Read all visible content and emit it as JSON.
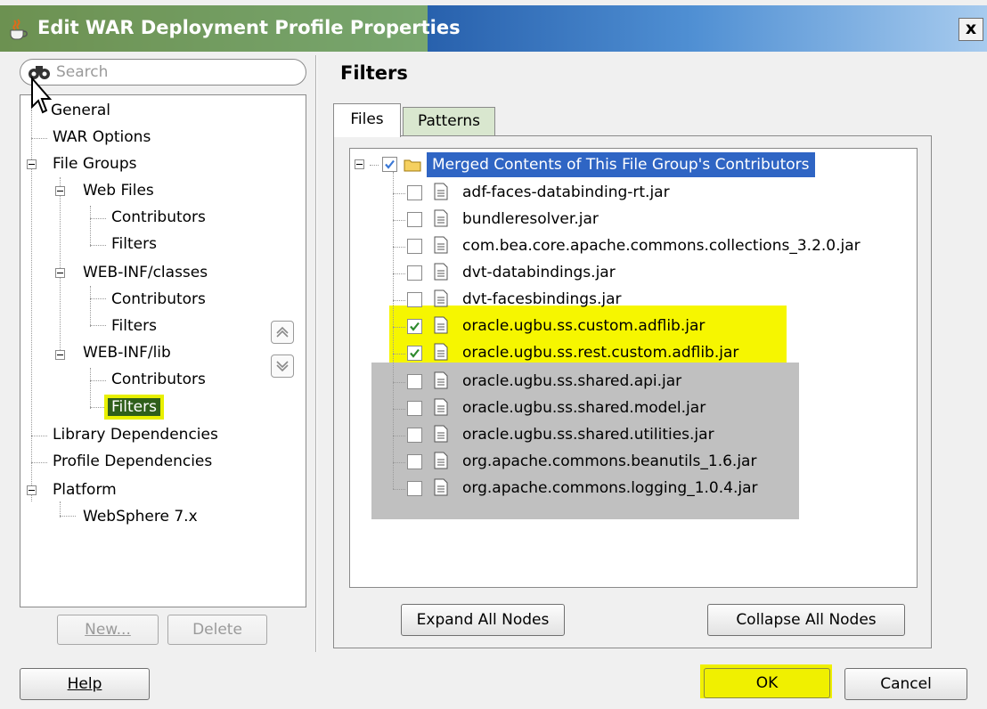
{
  "window": {
    "title": "Edit WAR Deployment Profile Properties",
    "close_label": "x"
  },
  "search": {
    "placeholder": "Search",
    "value": ""
  },
  "left_tree": {
    "items": [
      {
        "label": "General"
      },
      {
        "label": "WAR Options"
      },
      {
        "label": "File Groups"
      },
      {
        "label": "Web Files"
      },
      {
        "label": "Contributors"
      },
      {
        "label": "Filters"
      },
      {
        "label": "WEB-INF/classes"
      },
      {
        "label": "Contributors"
      },
      {
        "label": "Filters"
      },
      {
        "label": "WEB-INF/lib"
      },
      {
        "label": "Contributors"
      },
      {
        "label": "Filters",
        "selected": true
      },
      {
        "label": "Library Dependencies"
      },
      {
        "label": "Profile Dependencies"
      },
      {
        "label": "Platform"
      },
      {
        "label": "WebSphere 7.x"
      }
    ],
    "new_label": "New...",
    "delete_label": "Delete"
  },
  "panel": {
    "heading": "Filters",
    "tabs": [
      {
        "label": "Files",
        "active": true
      },
      {
        "label": "Patterns",
        "active": false
      }
    ],
    "root": {
      "label": "Merged Contents of This File Group's Contributors",
      "checked": true
    },
    "files": [
      {
        "name": "adf-faces-databinding-rt.jar",
        "checked": false
      },
      {
        "name": "bundleresolver.jar",
        "checked": false
      },
      {
        "name": "com.bea.core.apache.commons.collections_3.2.0.jar",
        "checked": false
      },
      {
        "name": "dvt-databindings.jar",
        "checked": false
      },
      {
        "name": "dvt-facesbindings.jar",
        "checked": false
      },
      {
        "name": "oracle.ugbu.ss.custom.adflib.jar",
        "checked": true
      },
      {
        "name": "oracle.ugbu.ss.rest.custom.adflib.jar",
        "checked": true
      },
      {
        "name": "oracle.ugbu.ss.shared.api.jar",
        "checked": false
      },
      {
        "name": "oracle.ugbu.ss.shared.model.jar",
        "checked": false
      },
      {
        "name": "oracle.ugbu.ss.shared.utilities.jar",
        "checked": false
      },
      {
        "name": "org.apache.commons.beanutils_1.6.jar",
        "checked": false
      },
      {
        "name": "org.apache.commons.logging_1.0.4.jar",
        "checked": false
      }
    ],
    "expand_label": "Expand All Nodes",
    "collapse_label": "Collapse All Nodes"
  },
  "footer": {
    "help_label": "Help",
    "ok_label": "OK",
    "cancel_label": "Cancel"
  },
  "colors": {
    "highlight_yellow": "#f6f600",
    "highlight_gray": "#c0c0c0",
    "root_selection": "#2f65c4",
    "selected_filter_bg": "#2f5f1a"
  }
}
